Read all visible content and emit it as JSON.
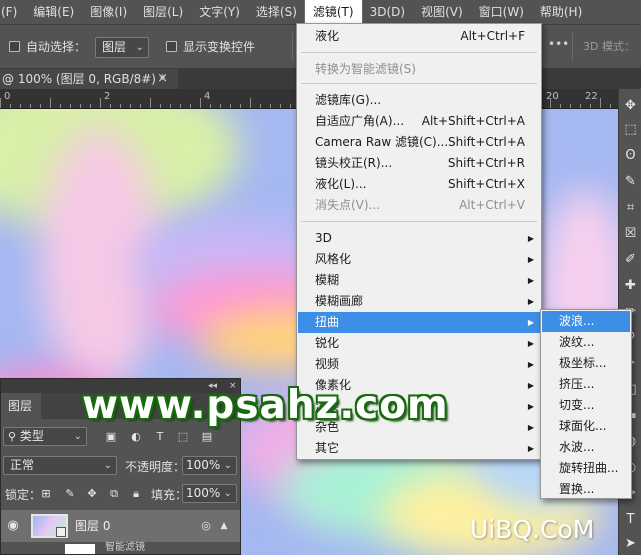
{
  "menubar": {
    "items": [
      "(F)",
      "编辑(E)",
      "图像(I)",
      "图层(L)",
      "文字(Y)",
      "选择(S)",
      "滤镜(T)",
      "3D(D)",
      "视图(V)",
      "窗口(W)",
      "帮助(H)"
    ],
    "active_index": 6
  },
  "options": {
    "auto_select_label": "自动选择：",
    "layer_combo": "图层",
    "show_transform_label": "显示变换控件",
    "mode_3d_label": "3D 模式：",
    "more": "•••"
  },
  "document_tab": {
    "title": "@ 100% (图层 0, RGB/8#) *",
    "close": "×"
  },
  "ruler": {
    "labels": [
      "0",
      "2",
      "4",
      "20",
      "22"
    ]
  },
  "filter_menu": {
    "items": [
      {
        "label": "液化",
        "shortcut": "Alt+Ctrl+F",
        "disabled": false,
        "submenu": false
      },
      {
        "label": "转换为智能滤镜(S)",
        "shortcut": "",
        "disabled": true,
        "submenu": false
      },
      {
        "label": "滤镜库(G)...",
        "shortcut": "",
        "disabled": false,
        "submenu": false
      },
      {
        "label": "自适应广角(A)...",
        "shortcut": "Alt+Shift+Ctrl+A",
        "disabled": false,
        "submenu": false
      },
      {
        "label": "Camera Raw 滤镜(C)...",
        "shortcut": "Shift+Ctrl+A",
        "disabled": false,
        "submenu": false
      },
      {
        "label": "镜头校正(R)...",
        "shortcut": "Shift+Ctrl+R",
        "disabled": false,
        "submenu": false
      },
      {
        "label": "液化(L)...",
        "shortcut": "Shift+Ctrl+X",
        "disabled": false,
        "submenu": false
      },
      {
        "label": "消失点(V)...",
        "shortcut": "Alt+Ctrl+V",
        "disabled": true,
        "submenu": false
      },
      {
        "label": "3D",
        "shortcut": "",
        "disabled": false,
        "submenu": true
      },
      {
        "label": "风格化",
        "shortcut": "",
        "disabled": false,
        "submenu": true
      },
      {
        "label": "模糊",
        "shortcut": "",
        "disabled": false,
        "submenu": true
      },
      {
        "label": "模糊画廊",
        "shortcut": "",
        "disabled": false,
        "submenu": true
      },
      {
        "label": "扭曲",
        "shortcut": "",
        "disabled": false,
        "submenu": true,
        "highlight": true
      },
      {
        "label": "锐化",
        "shortcut": "",
        "disabled": false,
        "submenu": true
      },
      {
        "label": "视频",
        "shortcut": "",
        "disabled": false,
        "submenu": true
      },
      {
        "label": "像素化",
        "shortcut": "",
        "disabled": false,
        "submenu": true
      },
      {
        "label": "渲染",
        "shortcut": "",
        "disabled": false,
        "submenu": true
      },
      {
        "label": "杂色",
        "shortcut": "",
        "disabled": false,
        "submenu": true
      },
      {
        "label": "其它",
        "shortcut": "",
        "disabled": false,
        "submenu": true
      }
    ],
    "submenu_arrow": "▶"
  },
  "distort_menu": {
    "items": [
      "波浪...",
      "波纹...",
      "极坐标...",
      "挤压...",
      "切变...",
      "球面化...",
      "水波...",
      "旋转扭曲...",
      "置换..."
    ],
    "highlight_index": 0
  },
  "layers_panel": {
    "tab_label": "图层",
    "filter_kind": "类型",
    "blend_mode": "正常",
    "opacity_label": "不透明度：",
    "opacity_value": "100%",
    "lock_label": "锁定：",
    "fill_label": "填充：",
    "fill_value": "100%",
    "layer_name": "图层 0",
    "smart_filter_label": "智能滤镜",
    "collapse": "◂◂",
    "close": "×"
  },
  "watermarks": {
    "psahz": "www.psahz.com",
    "uibq": "UiBQ.CoM"
  },
  "colors": {
    "menu_highlight": "#3d8ee6",
    "panel_bg": "#535353",
    "watermark_green": "#1a6b10"
  }
}
